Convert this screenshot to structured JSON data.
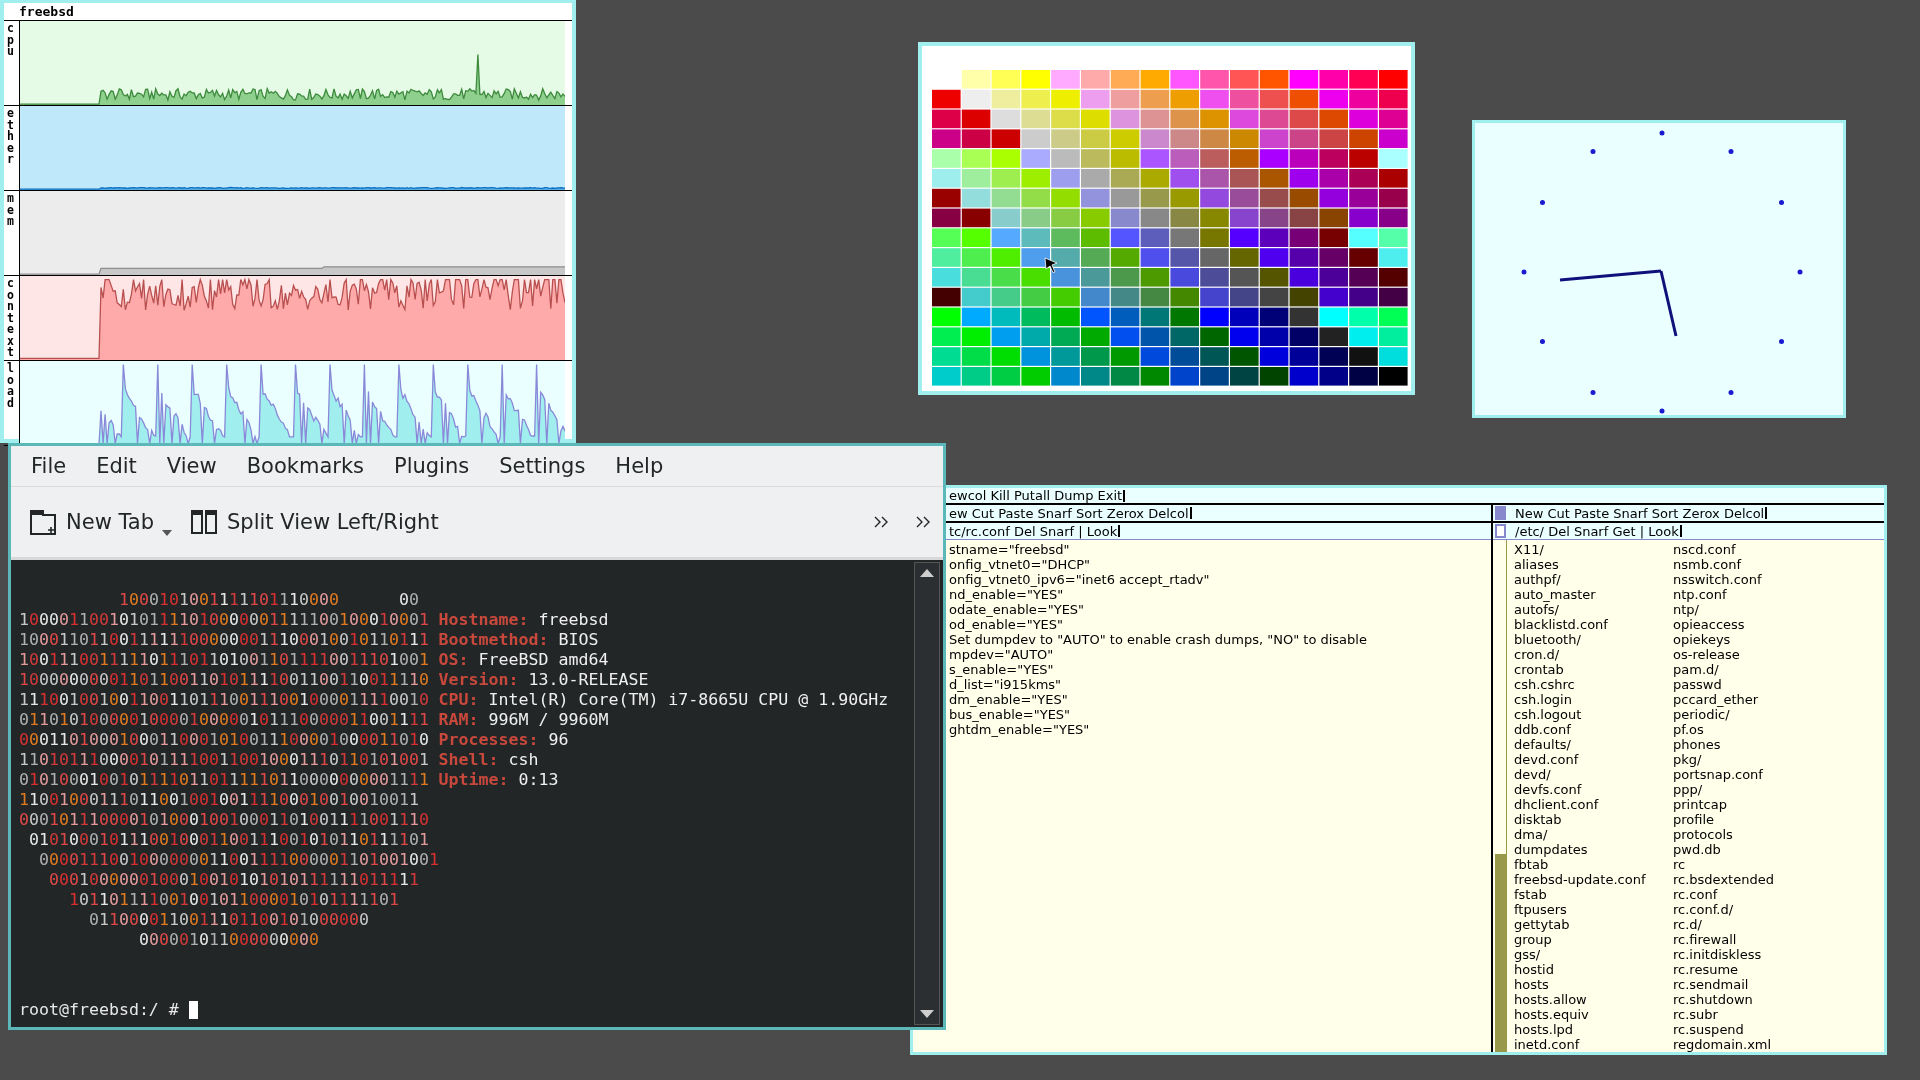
{
  "system_monitor": {
    "title": "freebsd",
    "graphs": [
      {
        "label": "cpu",
        "kind": "cpu"
      },
      {
        "label": "ether",
        "kind": "ether"
      },
      {
        "label": "mem",
        "kind": "mem"
      },
      {
        "label": "context",
        "kind": "context"
      },
      {
        "label": "load",
        "kind": "load"
      }
    ]
  },
  "terminal": {
    "menu": [
      "File",
      "Edit",
      "View",
      "Bookmarks",
      "Plugins",
      "Settings",
      "Help"
    ],
    "toolbar": [
      {
        "kind": "new-tab",
        "label": "New Tab"
      },
      {
        "kind": "split",
        "label": "Split View Left/Right"
      }
    ],
    "art": [
      "          1000101001111101110000      00",
      "10000110010101111010000001111100100010001",
      "10001101100111111000000011100010010110111",
      "10011100111110111011010011011110011101001",
      "10000000001101100110101111001100110011110",
      "11100100100110011011100111001000011110010",
      "01101010000010000100000101110000011001111",
      "00011010001000110001010011100001000011010",
      "11010111000010111100110010001110110101001",
      "01010001001011110110111110110000000001111",
      "1100100011101100100100111100010010010011",
      "00010111000010100010010001101001111001110",
      " 0101000101110010001100111001010110111101",
      "  0000111001000000011001111000001101001001",
      "   0001000000100010010101010111111011111",
      "     101101111001001011000010101111101",
      "       0110000110011101100101000000",
      "            000001011000000000"
    ],
    "info": [
      {
        "label": "Hostname:",
        "value": "freebsd"
      },
      {
        "label": "Bootmethod:",
        "value": "BIOS"
      },
      {
        "label": "OS:",
        "value": "FreeBSD amd64"
      },
      {
        "label": "Version:",
        "value": "13.0-RELEASE"
      },
      {
        "label": "CPU:",
        "value": "Intel(R) Core(TM) i7-8665U CPU @ 1.90GHz"
      },
      {
        "label": "RAM:",
        "value": "996M / 9960M"
      },
      {
        "label": "Processes:",
        "value": "96"
      },
      {
        "label": "Shell:",
        "value": "csh"
      },
      {
        "label": "Uptime:",
        "value": "0:13"
      }
    ],
    "prompt": "root@freebsd:/ #"
  },
  "editor": {
    "main_tag": "ewcol Kill Putall Dump Exit",
    "left_column": {
      "tag": "ew Cut Paste Snarf Sort Zerox Delcol",
      "window_tag": "tc/rc.conf Del Snarf | Look",
      "lines": [
        "stname=\"freebsd\"",
        "onfig_vtnet0=\"DHCP\"",
        "onfig_vtnet0_ipv6=\"inet6 accept_rtadv\"",
        "nd_enable=\"YES\"",
        "odate_enable=\"YES\"",
        "od_enable=\"YES\"",
        "Set dumpdev to \"AUTO\" to enable crash dumps, \"NO\" to disable",
        "mpdev=\"AUTO\"",
        "s_enable=\"YES\"",
        "d_list=\"i915kms\"",
        "dm_enable=\"YES\"",
        "bus_enable=\"YES\"",
        "ghtdm_enable=\"YES\""
      ]
    },
    "right_column": {
      "tag": "New Cut Paste Snarf Sort Zerox Delcol",
      "window_tag": "/etc/ Del Snarf Get | Look",
      "files": [
        [
          "X11/",
          "aliases",
          "authpf/",
          "auto_master",
          "autofs/",
          "blacklistd.conf",
          "bluetooth/",
          "cron.d/",
          "crontab",
          "csh.cshrc",
          "csh.login",
          "csh.logout",
          "ddb.conf",
          "defaults/",
          "devd.conf",
          "devd/",
          "devfs.conf",
          "dhclient.conf",
          "disktab",
          "dma/",
          "dumpdates",
          "fbtab",
          "freebsd-update.conf",
          "fstab",
          "ftpusers",
          "gettytab",
          "group",
          "gss/",
          "hostid",
          "hosts",
          "hosts.allow",
          "hosts.equiv",
          "hosts.lpd",
          "inetd.conf"
        ],
        [
          "nscd.conf",
          "nsmb.conf",
          "nsswitch.conf",
          "ntp.conf",
          "ntp/",
          "opieaccess",
          "opiekeys",
          "os-release",
          "pam.d/",
          "passwd",
          "pccard_ether",
          "periodic/",
          "pf.os",
          "phones",
          "pkg/",
          "portsnap.conf",
          "ppp/",
          "printcap",
          "profile",
          "protocols",
          "pwd.db",
          "rc",
          "rc.bsdextended",
          "rc.conf",
          "rc.conf.d/",
          "rc.d/",
          "rc.firewall",
          "rc.initdiskless",
          "rc.resume",
          "rc.sendmail",
          "rc.shutdown",
          "rc.subr",
          "rc.suspend",
          "regdomain.xml"
        ]
      ]
    }
  }
}
